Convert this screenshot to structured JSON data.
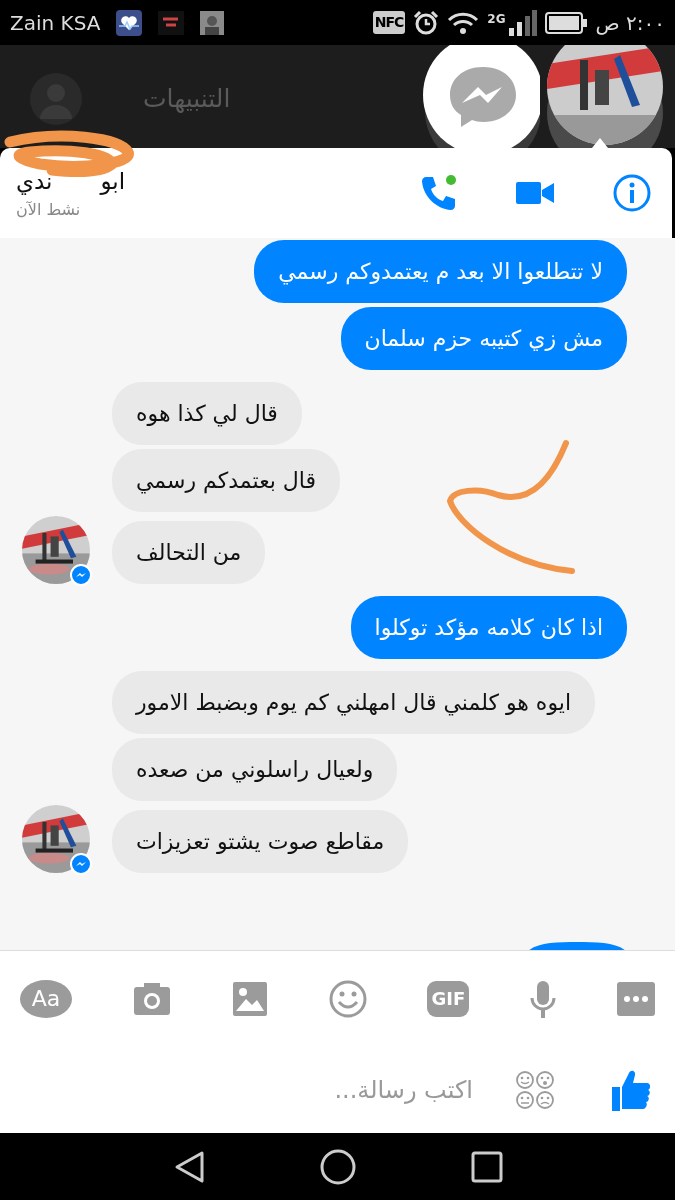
{
  "status_bar": {
    "carrier": "Zain KSA",
    "nfc": "NFC",
    "network": "2G",
    "time": "٢:٠٠ ص"
  },
  "notification": {
    "title": "التنبيهات"
  },
  "chat_header": {
    "name_start": "ابو",
    "name_end": "ندي",
    "status": "نشط الآن",
    "call_online": true
  },
  "groups": [
    {
      "kind": "sent",
      "messages": [
        "لا تتطلعوا الا بعد م يعتمدوكم رسمي",
        "مش زي كتيبه حزم سلمان"
      ]
    },
    {
      "kind": "received",
      "messages": [
        "قال لي كذا هوه",
        "قال بعتمدكم رسمي",
        "من التحالف"
      ]
    },
    {
      "kind": "sent",
      "messages": [
        "اذا كان كلامه مؤكد توكلوا"
      ]
    },
    {
      "kind": "received",
      "messages": [
        "ايوه هو كلمني قال امهلني كم يوم وبضبط الامور",
        "ولعيال راسلوني من صعده",
        "مقاطع صوت يشتو تعزيزات"
      ]
    }
  ],
  "toolbar": [
    {
      "kind": "more"
    },
    {
      "kind": "mic"
    },
    {
      "kind": "gif",
      "label": "GIF"
    },
    {
      "kind": "emoji"
    },
    {
      "kind": "gallery"
    },
    {
      "kind": "camera"
    },
    {
      "kind": "font",
      "label": "Aa"
    }
  ],
  "composer": {
    "placeholder": "اكتب رسالة..."
  }
}
